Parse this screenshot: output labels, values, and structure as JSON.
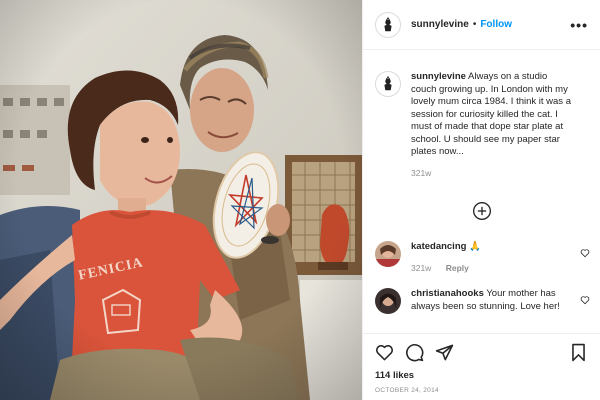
{
  "post": {
    "username": "sunnylevine",
    "follow_label": "Follow",
    "separator": "•",
    "more_label": "•••",
    "shirt_text": "FENICIA"
  },
  "caption": {
    "username": "sunnylevine",
    "text": "Always on a studio couch growing up. In London with my lovely mum circa 1984. I think it was a session for curiosity killed the cat. I must of made that dope star plate at school. U should see my paper star plates now...",
    "time": "321w"
  },
  "comments": [
    {
      "username": "katedancing",
      "text": "🙏",
      "time": "321w",
      "reply_label": "Reply"
    },
    {
      "username": "christianahooks",
      "text": "Your mother has always been so stunning. Love her!"
    }
  ],
  "actions": {
    "likes": "114 likes",
    "date": "OCTOBER 24, 2014"
  },
  "colors": {
    "accent": "#0095f6",
    "muted": "#8e8e8e",
    "text": "#262626"
  },
  "icons": [
    "more-icon",
    "add-comment-icon",
    "heart-icon",
    "comment-icon",
    "share-icon",
    "save-icon"
  ]
}
